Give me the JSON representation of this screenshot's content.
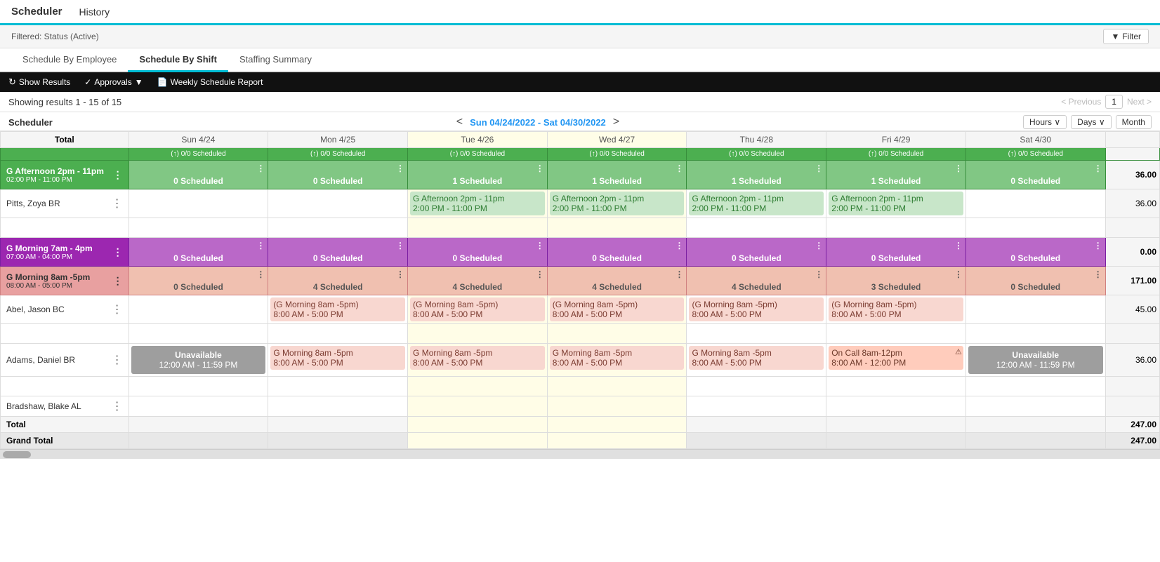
{
  "topbar": {
    "scheduler_label": "Scheduler",
    "history_label": "History"
  },
  "filter": {
    "status_text": "Filtered: Status (Active)",
    "filter_btn": "Filter"
  },
  "tabs": [
    {
      "id": "by-employee",
      "label": "Schedule By Employee",
      "active": false
    },
    {
      "id": "by-shift",
      "label": "Schedule By Shift",
      "active": true
    },
    {
      "id": "staffing",
      "label": "Staffing Summary",
      "active": false
    }
  ],
  "toolbar": {
    "show_results": "Show Results",
    "approvals": "Approvals",
    "weekly_report": "Weekly Schedule Report"
  },
  "results": {
    "text": "Showing results 1 - 15 of 15",
    "previous": "< Previous",
    "next": "Next >",
    "page": "1"
  },
  "scheduler": {
    "label": "Scheduler",
    "date_range": "Sun 04/24/2022 - Sat 04/30/2022",
    "hours_btn": "Hours ∨",
    "days_btn": "Days ∨",
    "month_btn": "Month",
    "total_label": "Total"
  },
  "days": [
    {
      "id": "sun",
      "label": "Sun 4/24",
      "highlight": false
    },
    {
      "id": "mon",
      "label": "Mon 4/25",
      "highlight": false
    },
    {
      "id": "tue",
      "label": "Tue 4/26",
      "highlight": true
    },
    {
      "id": "wed",
      "label": "Wed 4/27",
      "highlight": true
    },
    {
      "id": "thu",
      "label": "Thu 4/28",
      "highlight": false
    },
    {
      "id": "fri",
      "label": "Fri 4/29",
      "highlight": false
    },
    {
      "id": "sat",
      "label": "Sat 4/30",
      "highlight": false
    }
  ],
  "shift_groups": [
    {
      "id": "afternoon",
      "name": "G Afternoon 2pm - 11pm",
      "time": "02:00 PM - 11:00 PM",
      "color": "green",
      "row_above_label": "(↑) 0/0 Scheduled",
      "scheduled": [
        "0 Scheduled",
        "0 Scheduled",
        "1 Scheduled",
        "1 Scheduled",
        "1 Scheduled",
        "1 Scheduled",
        "0 Scheduled"
      ],
      "total": "36.00",
      "employees": [
        {
          "name": "Pitts, Zoya BR",
          "total": "36.00",
          "shifts": [
            {
              "day": "sun",
              "label": "",
              "time": ""
            },
            {
              "day": "mon",
              "label": "",
              "time": ""
            },
            {
              "day": "tue",
              "label": "G Afternoon 2pm - 11pm",
              "time": "2:00 PM - 11:00 PM",
              "color": "green"
            },
            {
              "day": "wed",
              "label": "G Afternoon 2pm - 11pm",
              "time": "2:00 PM - 11:00 PM",
              "color": "green"
            },
            {
              "day": "thu",
              "label": "G Afternoon 2pm - 11pm",
              "time": "2:00 PM - 11:00 PM",
              "color": "green"
            },
            {
              "day": "fri",
              "label": "G Afternoon 2pm - 11pm",
              "time": "2:00 PM - 11:00 PM",
              "color": "green"
            },
            {
              "day": "sat",
              "label": "",
              "time": ""
            }
          ]
        }
      ]
    },
    {
      "id": "morning7",
      "name": "G Morning 7am - 4pm",
      "time": "07:00 AM - 04:00 PM",
      "color": "purple",
      "row_above_label": "",
      "scheduled": [
        "0 Scheduled",
        "0 Scheduled",
        "0 Scheduled",
        "0 Scheduled",
        "0 Scheduled",
        "0 Scheduled",
        "0 Scheduled"
      ],
      "total": "0.00",
      "employees": []
    },
    {
      "id": "morning8",
      "name": "G Morning 8am -5pm",
      "time": "08:00 AM - 05:00 PM",
      "color": "salmon",
      "row_above_label": "",
      "scheduled": [
        "0 Scheduled",
        "4 Scheduled",
        "4 Scheduled",
        "4 Scheduled",
        "4 Scheduled",
        "3 Scheduled",
        "0 Scheduled"
      ],
      "total": "171.00",
      "employees": [
        {
          "name": "Abel, Jason BC",
          "total": "45.00",
          "shifts": [
            {
              "day": "sun",
              "label": "",
              "time": ""
            },
            {
              "day": "mon",
              "label": "(G Morning 8am -5pm)",
              "time": "8:00 AM - 5:00 PM",
              "color": "salmon"
            },
            {
              "day": "tue",
              "label": "(G Morning 8am -5pm)",
              "time": "8:00 AM - 5:00 PM",
              "color": "salmon"
            },
            {
              "day": "wed",
              "label": "(G Morning 8am -5pm)",
              "time": "8:00 AM - 5:00 PM",
              "color": "salmon"
            },
            {
              "day": "thu",
              "label": "(G Morning 8am -5pm)",
              "time": "8:00 AM - 5:00 PM",
              "color": "salmon"
            },
            {
              "day": "fri",
              "label": "(G Morning 8am -5pm)",
              "time": "8:00 AM - 5:00 PM",
              "color": "salmon"
            },
            {
              "day": "sat",
              "label": "",
              "time": ""
            }
          ]
        },
        {
          "name": "Adams, Daniel BR",
          "total": "36.00",
          "shifts": [
            {
              "day": "sun",
              "label": "Unavailable",
              "time": "12:00 AM - 11:59 PM",
              "color": "gray"
            },
            {
              "day": "mon",
              "label": "G Morning 8am -5pm",
              "time": "8:00 AM - 5:00 PM",
              "color": "salmon"
            },
            {
              "day": "tue",
              "label": "G Morning 8am -5pm",
              "time": "8:00 AM - 5:00 PM",
              "color": "salmon"
            },
            {
              "day": "wed",
              "label": "G Morning 8am -5pm",
              "time": "8:00 AM - 5:00 PM",
              "color": "salmon"
            },
            {
              "day": "thu",
              "label": "G Morning 8am -5pm",
              "time": "8:00 AM - 5:00 PM",
              "color": "salmon"
            },
            {
              "day": "fri",
              "label": "On Call 8am-12pm",
              "time": "8:00 AM - 12:00 PM",
              "color": "oncall"
            },
            {
              "day": "sat",
              "label": "Unavailable",
              "time": "12:00 AM - 11:59 PM",
              "color": "gray"
            }
          ]
        },
        {
          "name": "Bradshaw, Blake AL",
          "total": "",
          "shifts": [
            {
              "day": "sun",
              "label": "",
              "time": ""
            },
            {
              "day": "mon",
              "label": "",
              "time": ""
            },
            {
              "day": "tue",
              "label": "",
              "time": ""
            },
            {
              "day": "wed",
              "label": "",
              "time": ""
            },
            {
              "day": "thu",
              "label": "",
              "time": ""
            },
            {
              "day": "fri",
              "label": "",
              "time": ""
            },
            {
              "day": "sat",
              "label": "",
              "time": ""
            }
          ]
        }
      ]
    }
  ],
  "totals": {
    "total_label": "Total",
    "total_value": "247.00",
    "grand_total_label": "Grand Total",
    "grand_total_value": "247.00"
  }
}
